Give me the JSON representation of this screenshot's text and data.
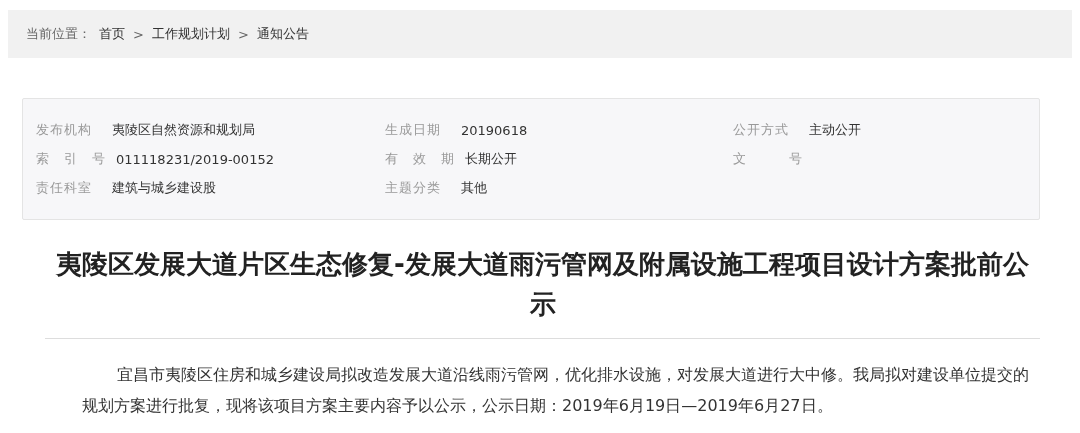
{
  "breadcrumb": {
    "label": "当前位置：",
    "items": [
      "首页",
      "工作规划计划",
      "通知公告"
    ],
    "separator": ">"
  },
  "meta": [
    {
      "label": "发布机构",
      "value": "夷陵区自然资源和规划局"
    },
    {
      "label": "生成日期",
      "value": "20190618"
    },
    {
      "label": "公开方式",
      "value": "主动公开"
    },
    {
      "label": "索　引　号",
      "value": "011118231/2019-00152"
    },
    {
      "label": "有　效　期",
      "value": "长期公开"
    },
    {
      "label": "文　　　号"
    },
    {
      "label": "责任科室",
      "value": "建筑与城乡建设股"
    },
    {
      "label": "主题分类",
      "value": "其他"
    }
  ],
  "title": "夷陵区发展大道片区生态修复-发展大道雨污管网及附属设施工程项目设计方案批前公示",
  "body": "宜昌市夷陵区住房和城乡建设局拟改造发展大道沿线雨污管网，优化排水设施，对发展大道进行大中修。我局拟对建设单位提交的规划方案进行批复，现将该项目方案主要内容予以公示，公示日期：2019年6月19日—2019年6月27日。"
}
